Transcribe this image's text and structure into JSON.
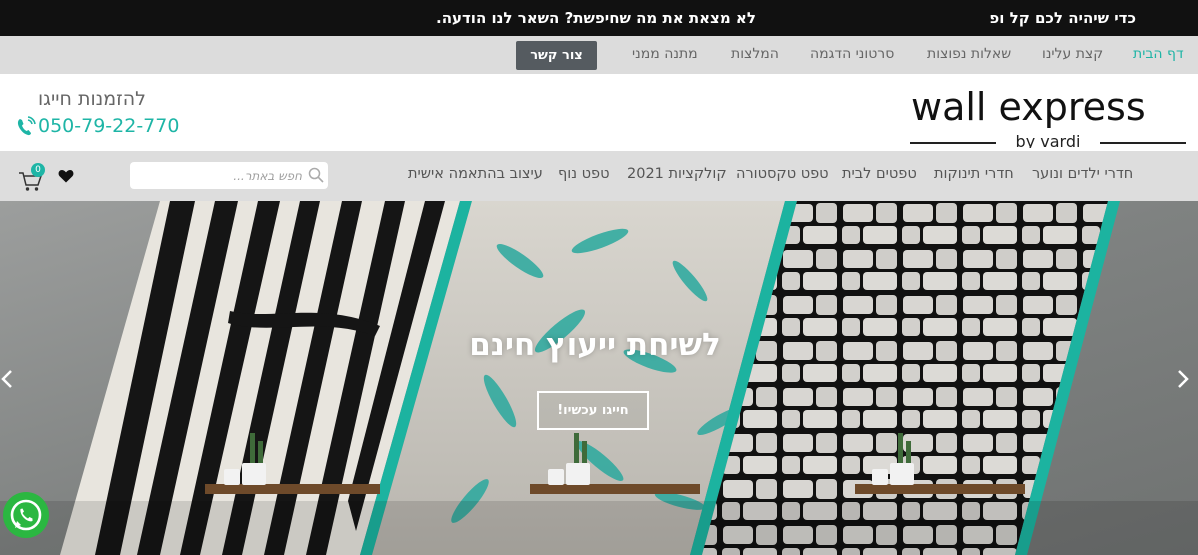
{
  "announcement": {
    "main": "לא מצאת את מה שחיפשת? השאר לנו הודעה.",
    "edge": "כדי שיהיה לכם קל ופ"
  },
  "topnav": {
    "items": [
      "דף הבית",
      "קצת עלינו",
      "שאלות נפוצות",
      "סרטוני הדגמה",
      "המלצות",
      "מתנה ממני"
    ],
    "contact_button": "צור קשר"
  },
  "header": {
    "logo": {
      "main": "wall express",
      "sub": "by vardi"
    },
    "phone_label": "להזמנות חייגו",
    "phone_number": "050-79-22-770"
  },
  "catnav": {
    "items": [
      "חדרי ילדים ונוער",
      "חדרי תינוקות",
      "טפטים לבית",
      "טפט טקסטורה",
      "קולקציות 2021",
      "טפט נוף",
      "עיצוב בהתאמה אישית"
    ],
    "search_placeholder": "חפש באתר...",
    "cart_count": "0"
  },
  "hero": {
    "title": "לשיחת ייעוץ חינם",
    "button": "חייגו עכשיו!"
  },
  "colors": {
    "accent": "#1eb5a6",
    "announcement_bg": "#111111",
    "nav_bg": "#dcdcdc",
    "contact_button_bg": "#555b60",
    "whatsapp": "#2bb741"
  }
}
